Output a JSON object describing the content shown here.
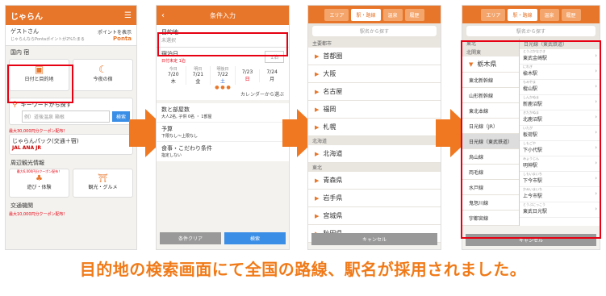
{
  "panel1": {
    "logo": "じゃらん",
    "guest": "ゲストさん",
    "points_note": "じゃらんならPontaポイントが2%たまる",
    "points_link": "ポイントを表示",
    "ponta": "Ponta",
    "domestic": "国内 宿",
    "date_dest": "日付と目的地",
    "tonight": "今夜の宿",
    "keyword_label": "キーワードから探す",
    "keyword_placeholder": "例）道後温泉 箱根",
    "search": "検索",
    "coupon1": "最大30,000円分クーポン配布！",
    "pack_title": "じゃらんパック(交通＋宿)",
    "pack_airlines": "JAL  ANA  JR",
    "sightseeing": "周辺観光情報",
    "coupon2": "最大6,000円分クーポン配布！",
    "play": "遊び・体験",
    "gourmet": "観光・グルメ",
    "transport": "交通機関",
    "coupon3": "最大10,000円分クーポン配布！"
  },
  "panel2": {
    "title": "条件入力",
    "dest_label": "目的地",
    "dest_value": "未選択",
    "date_label": "宿泊日",
    "date_value": "日付未定 1泊",
    "nights": "1泊",
    "day_heads": [
      "今日",
      "明日",
      "明後日",
      "",
      ""
    ],
    "dates": [
      "7/20",
      "7/21",
      "7/22",
      "7/23",
      "7/24"
    ],
    "weekdays": [
      "木",
      "金",
      "土",
      "日",
      "月"
    ],
    "calendar_link": "カレンダーから選ぶ",
    "rooms_label": "数と部屋数",
    "rooms_value": "大人2名, 子供 0名 ・ 1部屋",
    "budget_label": "予算",
    "budget_value": "下限なし〜上限なし",
    "meal_label": "食事・こだわり条件",
    "meal_value": "指定しない",
    "clear": "条件クリア",
    "search": "検索"
  },
  "panel3": {
    "tabs": [
      "エリア",
      "駅・路線",
      "温泉",
      "履歴"
    ],
    "search_placeholder": "駅名から探す",
    "section1": "主要都市",
    "cities": [
      "首都圏",
      "大阪",
      "名古屋",
      "福岡",
      "札幌"
    ],
    "section_hokkaido": "北海道",
    "hokkaido": "北海道",
    "section_tohoku": "東北",
    "prefs": [
      "青森県",
      "岩手県",
      "宮城県",
      "秋田県"
    ],
    "cancel": "キャンセル"
  },
  "panel4": {
    "tabs": [
      "エリア",
      "駅・路線",
      "温泉",
      "履歴"
    ],
    "search_placeholder": "駅名から探す",
    "region": "東北",
    "kanto": "北関東",
    "pref": "栃木県",
    "lines": [
      "東北新幹線",
      "山形新幹線",
      "東北本線",
      "日光線（JR）",
      "日光線（東武鉄道）",
      "烏山線",
      "両毛線",
      "水戸線",
      "鬼怒川線",
      "宇都宮線"
    ],
    "line_header": "日光線（東武鉄道）",
    "stations": [
      {
        "kana": "とうぶかなさき",
        "name": "東武金崎駅"
      },
      {
        "kana": "にれぎ",
        "name": "楡木駅"
      },
      {
        "kana": "もみやま",
        "name": "樅山駅"
      },
      {
        "kana": "しんかぬま",
        "name": "新鹿沼駅"
      },
      {
        "kana": "きたかぬま",
        "name": "北鹿沼駅"
      },
      {
        "kana": "いたが",
        "name": "板荷駅"
      },
      {
        "kana": "しもごや",
        "name": "下小代駅"
      },
      {
        "kana": "みょうじん",
        "name": "明神駅"
      },
      {
        "kana": "しもいまいち",
        "name": "下今市駅"
      },
      {
        "kana": "かみいまいち",
        "name": "上今市駅"
      },
      {
        "kana": "とうぶにっこう",
        "name": "東武日光駅"
      }
    ],
    "cancel": "キャンセル"
  },
  "caption": "目的地の検索画面にて全国の路線、駅名が採用されました。",
  "colors": {
    "accent": "#e8762a",
    "highlight": "#e60012",
    "caption": "#f07a18"
  }
}
